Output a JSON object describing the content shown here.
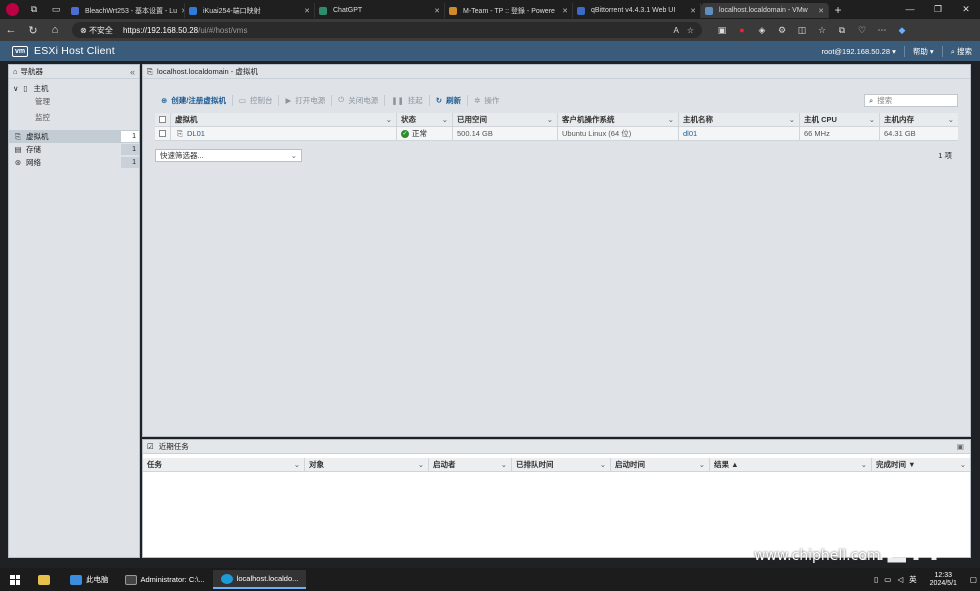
{
  "browser": {
    "tabs": [
      {
        "title": "BleachWrt253 - 基本设置 - Lu",
        "color": "#4a6fd1"
      },
      {
        "title": "iKuai254-端口映射",
        "color": "#2f7bd8"
      },
      {
        "title": "ChatGPT",
        "color": "#2c8c6d"
      },
      {
        "title": "M-Team - TP :: 登錄 - Powere",
        "color": "#d08a2a"
      },
      {
        "title": "qBittorrent v4.4.3.1 Web UI",
        "color": "#3c6bc4"
      },
      {
        "title": "localhost.localdomain - VMw",
        "color": "#5e8fc0",
        "active": true
      }
    ],
    "insecure_label": "不安全",
    "url_host": "https://192.168.50.28",
    "url_path": "/ui/#/host/vms"
  },
  "esxi": {
    "brand": "vm",
    "title": "ESXi Host Client",
    "user": "root@192.168.50.28",
    "help": "帮助",
    "search": "搜索"
  },
  "navigator": {
    "title": "导航器",
    "host": "主机",
    "host_children": [
      "管理",
      "监控"
    ],
    "items": [
      {
        "label": "虚拟机",
        "count": "1"
      },
      {
        "label": "存储",
        "count": "1"
      },
      {
        "label": "网络",
        "count": "1"
      }
    ]
  },
  "main": {
    "breadcrumb": "localhost.localdomain - 虚拟机",
    "toolbar": {
      "create": "创建/注册虚拟机",
      "console": "控制台",
      "power_on": "打开电源",
      "power_off": "关闭电源",
      "suspend": "挂起",
      "refresh": "刷新",
      "actions": "操作"
    },
    "search_placeholder": "搜索",
    "columns": [
      "虚拟机",
      "状态",
      "已用空间",
      "客户机操作系统",
      "主机名称",
      "主机 CPU",
      "主机内存"
    ],
    "row": {
      "name": "DL01",
      "status": "正常",
      "used": "500.14 GB",
      "os": "Ubuntu Linux (64 位)",
      "hostname": "dl01",
      "cpu": "66 MHz",
      "memory": "64.31 GB"
    },
    "filter_label": "快速筛选器...",
    "count": "1 项"
  },
  "tasks": {
    "title": "近期任务",
    "columns": [
      "任务",
      "对象",
      "启动者",
      "已排队时间",
      "启动时间",
      "结果 ▲",
      "完成时间 ▼"
    ]
  },
  "watermark": "www.chiphell.com",
  "taskbar": {
    "items": [
      "此电脑",
      "Administrator: C:\\...",
      "localhost.localdo..."
    ],
    "ime": "英",
    "time": "12:33",
    "date": "2024/5/1"
  }
}
